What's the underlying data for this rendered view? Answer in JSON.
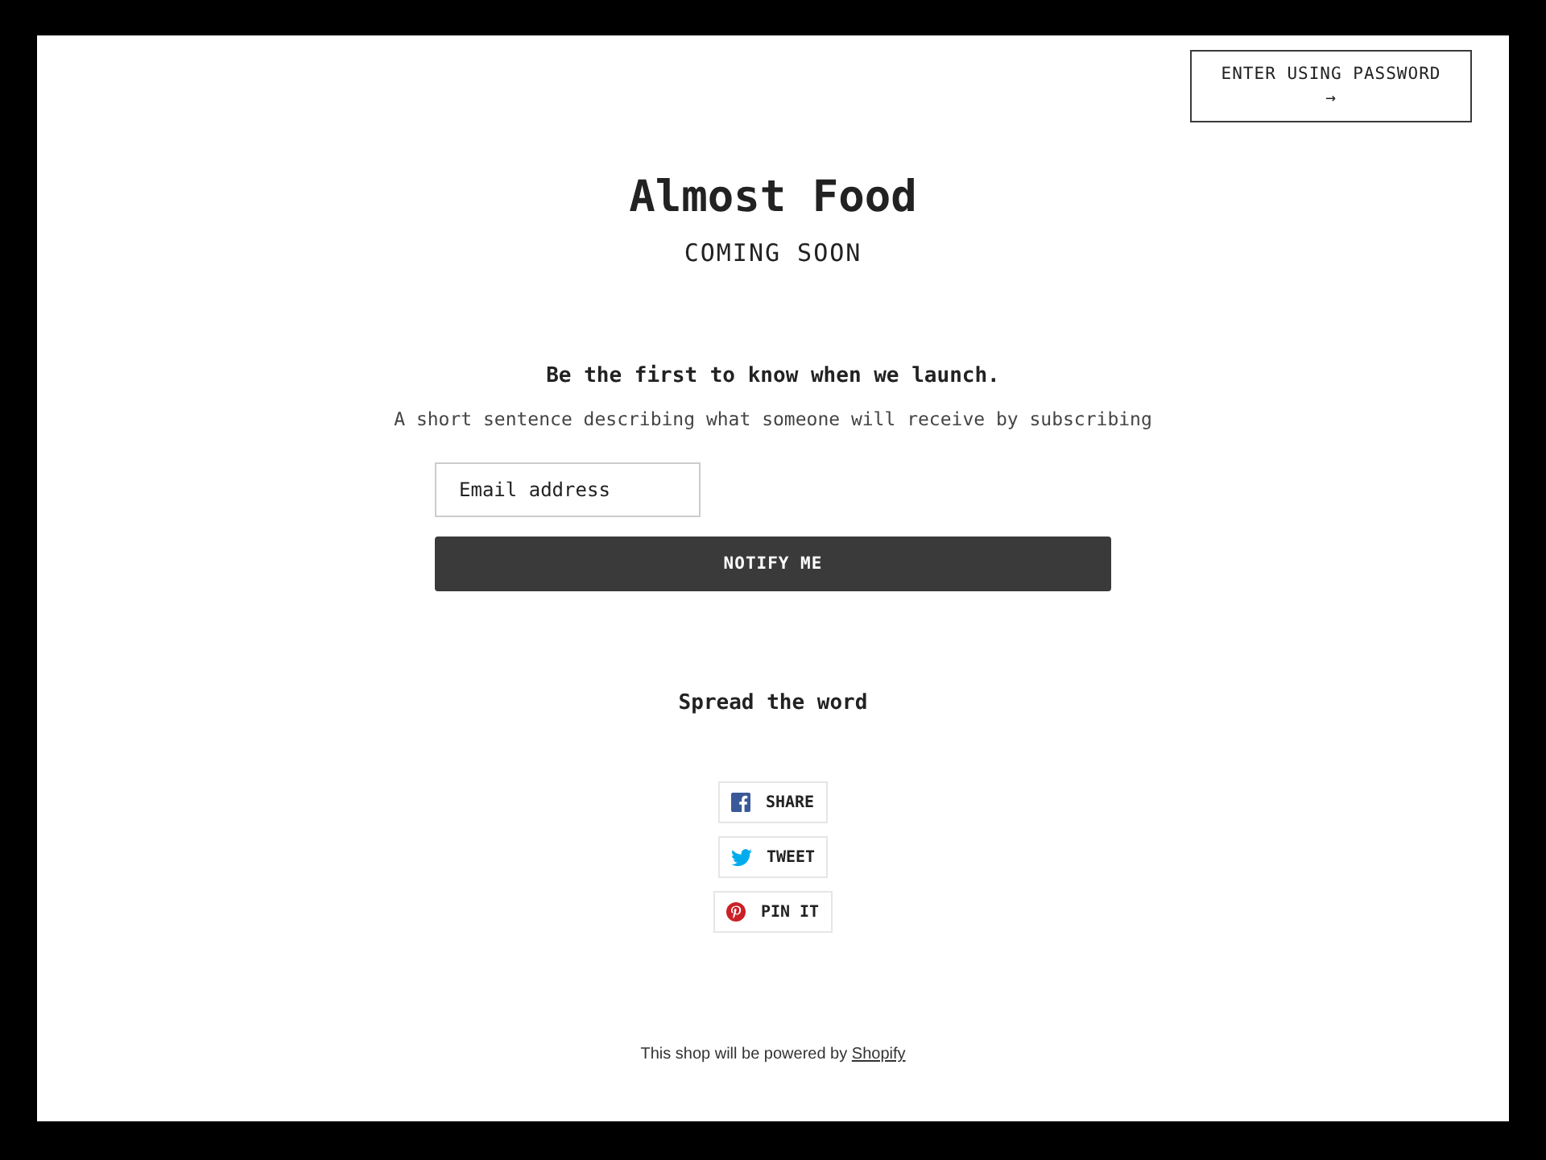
{
  "password_button": {
    "label": "ENTER USING PASSWORD",
    "arrow": "→"
  },
  "header": {
    "title": "Almost Food",
    "subtitle": "COMING SOON"
  },
  "signup": {
    "heading": "Be the first to know when we launch.",
    "text": "A short sentence describing what someone will receive by subscribing",
    "email": {
      "placeholder": "Email address"
    },
    "button": "NOTIFY ME"
  },
  "share": {
    "heading": "Spread the word",
    "buttons": [
      {
        "kind": "facebook",
        "label": "SHARE"
      },
      {
        "kind": "twitter",
        "label": "TWEET"
      },
      {
        "kind": "pinterest",
        "label": "PIN IT"
      }
    ]
  },
  "footer": {
    "text": "This shop will be powered by",
    "link": "Shopify"
  }
}
